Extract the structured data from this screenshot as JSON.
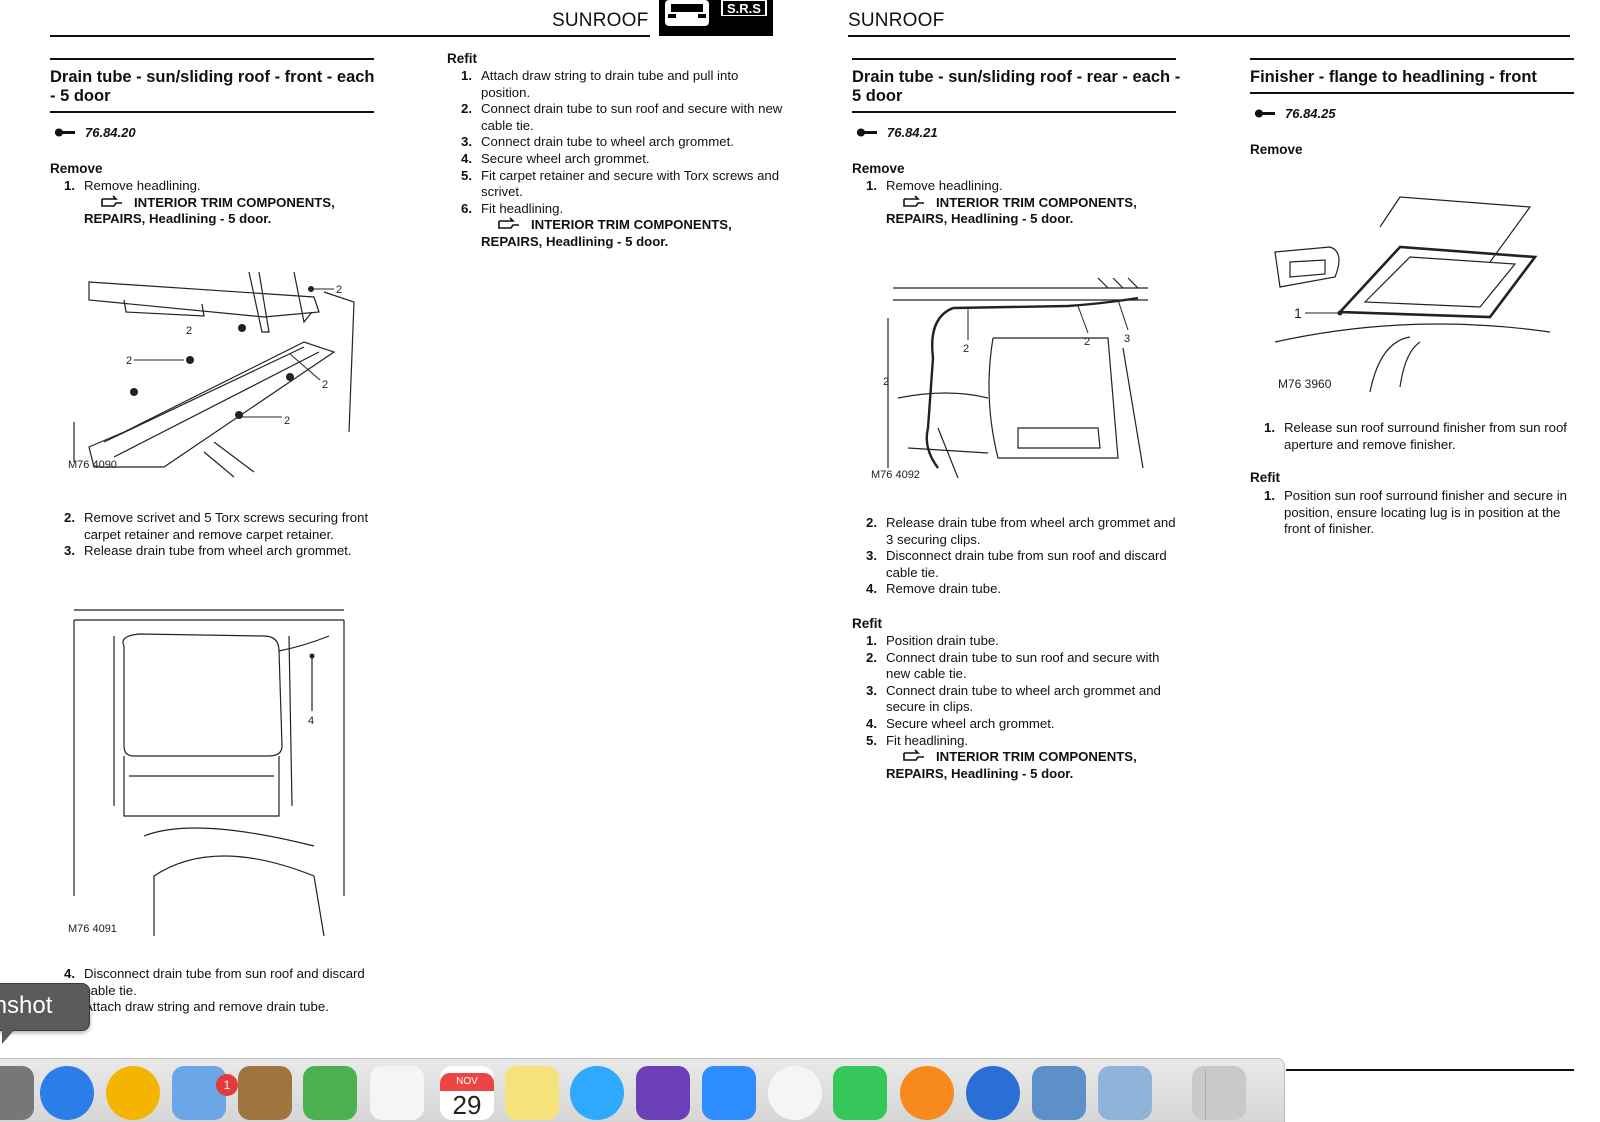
{
  "header": {
    "left_title": "SUNROOF",
    "right_title": "SUNROOF",
    "logo_text": "S.R.S"
  },
  "col1": {
    "title": "Drain tube - sun/sliding roof - front - each - 5 door",
    "code": "76.84.20",
    "remove_label": "Remove",
    "step1": "Remove headlining.",
    "xref1": "INTERIOR TRIM COMPONENTS, REPAIRS, Headlining - 5 door.",
    "fig1": {
      "ref": "M76 4090",
      "callouts": [
        "2",
        "2",
        "2",
        "2",
        "2",
        "2"
      ]
    },
    "steps_a": [
      {
        "num": "2.",
        "text": "Remove scrivet and 5 Torx screws securing front carpet retainer and remove carpet retainer."
      },
      {
        "num": "3.",
        "text": "Release drain tube from wheel arch grommet."
      }
    ],
    "fig2": {
      "ref": "M76 4091",
      "callout": "4"
    },
    "steps_b": [
      {
        "num": "4.",
        "text": "Disconnect drain tube from sun roof and discard cable tie."
      },
      {
        "num": "5.",
        "text": "Attach draw string and remove drain tube."
      }
    ]
  },
  "col2": {
    "refit_label": "Refit",
    "steps": [
      {
        "num": "1.",
        "text": "Attach draw string to drain tube and pull into position."
      },
      {
        "num": "2.",
        "text": "Connect drain tube to sun roof and secure with new cable tie."
      },
      {
        "num": "3.",
        "text": "Connect drain tube to wheel arch grommet."
      },
      {
        "num": "4.",
        "text": "Secure wheel arch grommet."
      },
      {
        "num": "5.",
        "text": "Fit carpet retainer and secure with Torx screws and scrivet."
      },
      {
        "num": "6.",
        "text": "Fit headlining."
      }
    ],
    "xref": "INTERIOR TRIM COMPONENTS, REPAIRS, Headlining - 5 door."
  },
  "col3": {
    "title": "Drain tube - sun/sliding roof - rear - each - 5 door",
    "code": "76.84.21",
    "remove_label": "Remove",
    "step1": "Remove headlining.",
    "xref1": "INTERIOR TRIM COMPONENTS, REPAIRS, Headlining - 5 door.",
    "fig": {
      "ref": "M76 4092",
      "callouts": [
        "2",
        "2",
        "3",
        "2"
      ]
    },
    "steps_a": [
      {
        "num": "2.",
        "text": "Release drain tube from wheel arch grommet and 3 securing clips."
      },
      {
        "num": "3.",
        "text": "Disconnect drain tube from sun roof and discard cable tie."
      },
      {
        "num": "4.",
        "text": "Remove drain tube."
      }
    ],
    "refit_label": "Refit",
    "refit_steps": [
      {
        "num": "1.",
        "text": "Position drain tube."
      },
      {
        "num": "2.",
        "text": "Connect drain tube to sun roof and secure with new cable tie."
      },
      {
        "num": "3.",
        "text": "Connect drain tube to wheel arch grommet and secure in clips."
      },
      {
        "num": "4.",
        "text": "Secure wheel arch grommet."
      },
      {
        "num": "5.",
        "text": "Fit headlining."
      }
    ],
    "xref2": "INTERIOR TRIM COMPONENTS, REPAIRS, Headlining - 5 door."
  },
  "col4": {
    "title": "Finisher - flange to headlining - front",
    "code": "76.84.25",
    "remove_label": "Remove",
    "fig": {
      "ref": "M76 3960",
      "callout": "1"
    },
    "steps": [
      {
        "num": "1.",
        "text": "Release sun roof surround finisher from sun roof aperture and remove finisher."
      }
    ],
    "refit_label": "Refit",
    "refit_steps": [
      {
        "num": "1.",
        "text": "Position sun roof surround finisher and secure in position, ensure locating lug is in position at the front of finisher."
      }
    ]
  },
  "overlay": {
    "tooltip_text": "Screenshot",
    "calendar": {
      "month": "NOV",
      "day": "29"
    },
    "mail_badge": "1"
  },
  "dock_icons": [
    "screenshot-icon",
    "safari-icon",
    "chrome-icon",
    "mail-icon",
    "contacts-icon",
    "maps-icon",
    "reminders-icon",
    "calendar-icon",
    "notes-icon",
    "messages-icon",
    "imovie-icon",
    "zoom-icon",
    "photos-icon",
    "facetime-icon",
    "books-icon",
    "wifi-utility-icon",
    "network-utility-icon",
    "preview-icon",
    "trash-icon"
  ],
  "colors": {
    "text": "#111111",
    "dock": "#dcdcdc",
    "tooltip": "#5a5a5a"
  }
}
